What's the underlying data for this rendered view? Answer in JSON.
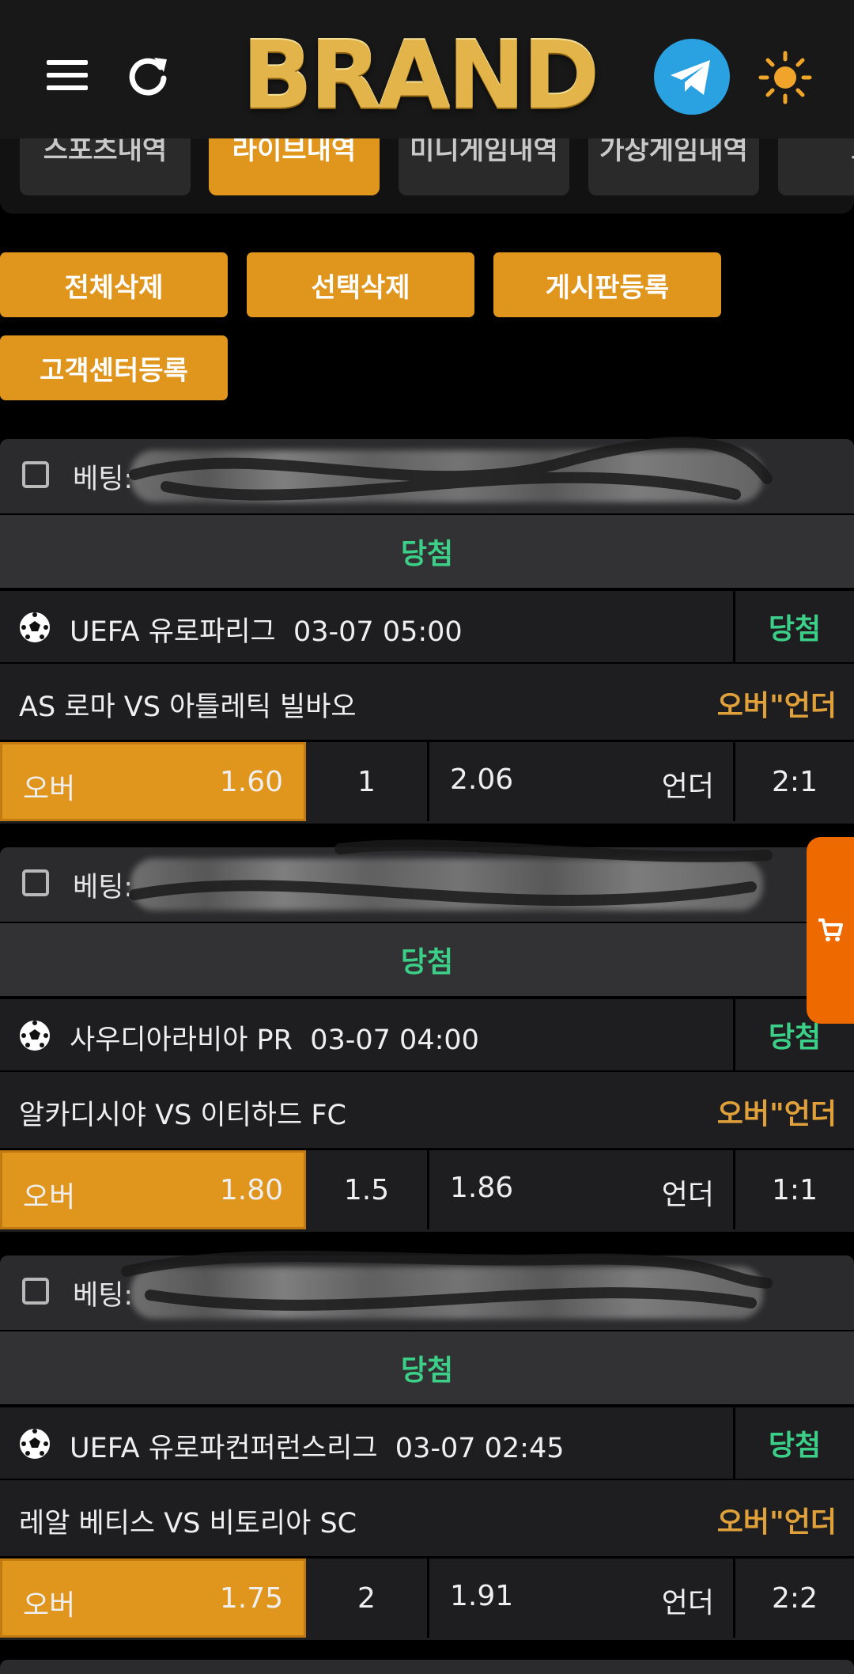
{
  "header": {
    "brand": "BRAND"
  },
  "tabs": [
    {
      "label": "스포츠내역",
      "active": false
    },
    {
      "label": "라이브내역",
      "active": true
    },
    {
      "label": "미니게임내역",
      "active": false
    },
    {
      "label": "가상게임내역",
      "active": false
    },
    {
      "label": "토",
      "active": false
    }
  ],
  "actions": {
    "delete_all": "전체삭제",
    "delete_selected": "선택삭제",
    "board_register": "게시판등록",
    "cs_register": "고객센터등록"
  },
  "colors": {
    "accent": "#e0951c",
    "win": "#3ccf88",
    "market": "#e0a13a",
    "cart": "#ee6a00"
  },
  "bets": [
    {
      "label": "베팅:",
      "status": "당첨",
      "league": "UEFA 유로파리그",
      "datetime": "03-07 05:00",
      "league_status": "당첨",
      "match": "AS 로마 VS 아틀레틱 빌바오",
      "market": "오버\"언더",
      "over_label": "오버",
      "over_odds": "1.60",
      "line": "1",
      "under_odds": "2.06",
      "under_label": "언더",
      "score": "2:1"
    },
    {
      "label": "베팅:",
      "status": "당첨",
      "league": "사우디아라비아 PR",
      "datetime": "03-07 04:00",
      "league_status": "당첨",
      "match": "알카디시야 VS 이티하드 FC",
      "market": "오버\"언더",
      "over_label": "오버",
      "over_odds": "1.80",
      "line": "1.5",
      "under_odds": "1.86",
      "under_label": "언더",
      "score": "1:1"
    },
    {
      "label": "베팅:",
      "status": "당첨",
      "league": "UEFA 유로파컨퍼런스리그",
      "datetime": "03-07 02:45",
      "league_status": "당첨",
      "match": "레알 베티스 VS 비토리아 SC",
      "market": "오버\"언더",
      "over_label": "오버",
      "over_odds": "1.75",
      "line": "2",
      "under_odds": "1.91",
      "under_label": "언더",
      "score": "2:2"
    }
  ]
}
